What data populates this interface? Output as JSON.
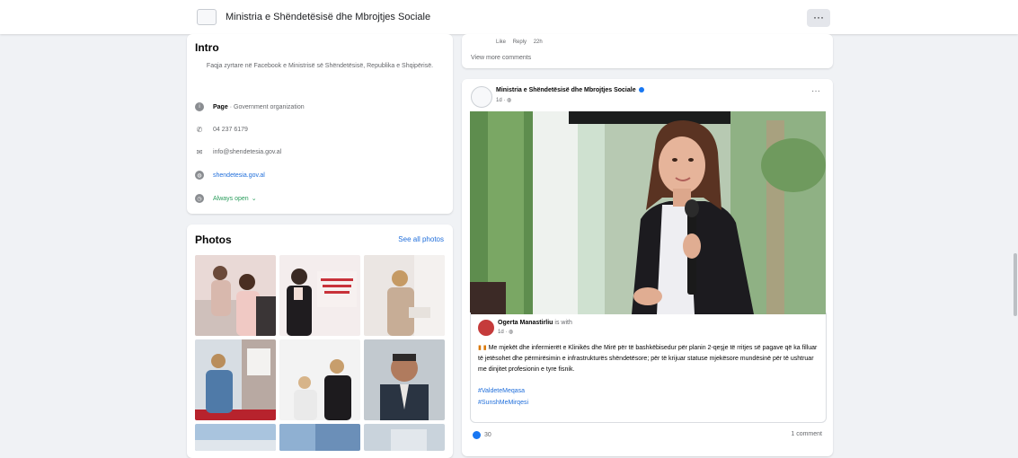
{
  "header": {
    "page_name": "Ministria e Shëndetësisë dhe Mbrojtjes Sociale",
    "more_label": "···"
  },
  "intro": {
    "title": "Intro",
    "description": "Faqja zyrtare në Facebook e Ministrisë së Shëndetësisë, Republika e Shqipërisë.",
    "category_label": "Page",
    "category_value": " · Government organization",
    "phone": "04 237 6179",
    "email": "info@shendetesia.gov.al",
    "website": "shendetesia.gov.al",
    "hours": "Always open"
  },
  "photos": {
    "title": "Photos",
    "see_all": "See all photos"
  },
  "comments_card": {
    "like": "Like",
    "reply": "Reply",
    "time": "22h",
    "view_more": "View more comments"
  },
  "post": {
    "author": "Ministria e Shëndetësisë dhe Mbrojtjes Sociale",
    "time": "1d",
    "more_label": "···",
    "shared": {
      "author": "Ogerta Manastirliu",
      "action": "is with",
      "time": "1d",
      "text": "Me mjekët dhe infermierët e Klinikës dhe Mirë për të bashkëbisedur për planin 2-qeşje të rritjes së pagave që ka filluar të jetësohet dhe përmirësimin e infrastrukturës shëndetësore; për të krijuar statuse mjekësore mundësinë për të ushtruar me dinjitet profesionin e tyre fisnik.",
      "tags": [
        "#ValdeteMeqasa",
        "#SunshMeMirqesi"
      ]
    },
    "reactions": "30",
    "comments": "1 comment"
  },
  "colors": {
    "link": "#216fdb",
    "background": "#f0f2f5",
    "verified": "#1877f2"
  }
}
